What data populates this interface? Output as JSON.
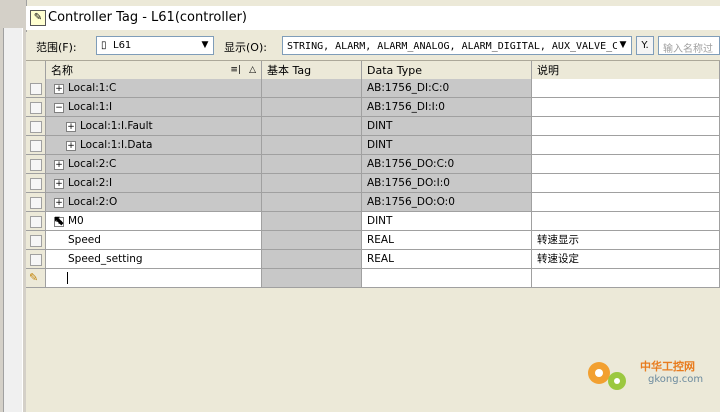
{
  "window": {
    "title": "Controller Tag - L61(controller)"
  },
  "toolbar": {
    "scope_label": "范围(F):",
    "scope_value": "L61",
    "show_label": "显示(O):",
    "show_value": "STRING, ALARM, ALARM_ANALOG, ALARM_DIGITAL, AUX_VALVE_C",
    "search_placeholder": "输入名称过"
  },
  "table": {
    "columns": [
      "名称",
      "基本 Tag",
      "Data Type",
      "说明"
    ],
    "sort_indicator": "△",
    "rows": [
      {
        "name": "Local:1:C",
        "expander": "+",
        "indent": 0,
        "base": "",
        "type": "AB:1756_DI:C:0",
        "desc": "",
        "gray": true
      },
      {
        "name": "Local:1:I",
        "expander": "−",
        "indent": 0,
        "base": "",
        "type": "AB:1756_DI:I:0",
        "desc": "",
        "gray": true
      },
      {
        "name": "Local:1:I.Fault",
        "expander": "+",
        "indent": 1,
        "base": "",
        "type": "DINT",
        "desc": "",
        "gray": true
      },
      {
        "name": "Local:1:I.Data",
        "expander": "+",
        "indent": 1,
        "base": "",
        "type": "DINT",
        "desc": "",
        "gray": true
      },
      {
        "name": "Local:2:C",
        "expander": "+",
        "indent": 0,
        "base": "",
        "type": "AB:1756_DO:C:0",
        "desc": "",
        "gray": true
      },
      {
        "name": "Local:2:I",
        "expander": "+",
        "indent": 0,
        "base": "",
        "type": "AB:1756_DO:I:0",
        "desc": "",
        "gray": true
      },
      {
        "name": "Local:2:O",
        "expander": "+",
        "indent": 0,
        "base": "",
        "type": "AB:1756_DO:O:0",
        "desc": "",
        "gray": true
      },
      {
        "name": "M0",
        "expander": "+",
        "indent": 0,
        "base": "",
        "type": "DINT",
        "desc": "",
        "gray": false
      },
      {
        "name": "Speed",
        "expander": "",
        "indent": 0,
        "base": "",
        "type": "REAL",
        "desc": "转速显示",
        "gray": false
      },
      {
        "name": "Speed_setting",
        "expander": "",
        "indent": 0,
        "base": "",
        "type": "REAL",
        "desc": "转速设定",
        "gray": false
      }
    ]
  },
  "watermark": {
    "line1": "中华工控网",
    "line2": "gkong.com"
  },
  "colors": {
    "gray_cell": "#c8c8c8",
    "header": "#ece9d8",
    "border": "#a0a0a0",
    "watermark_orange": "#e87c1f"
  }
}
